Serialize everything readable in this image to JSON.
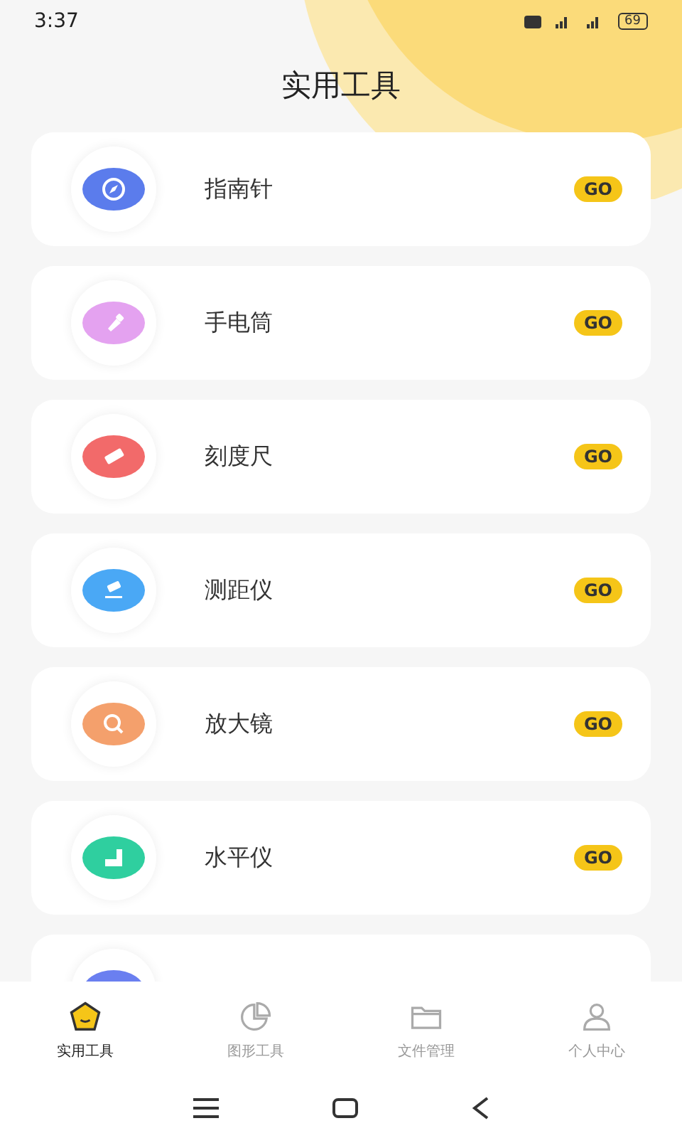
{
  "status_bar": {
    "time": "3:37",
    "battery": "69"
  },
  "header": {
    "title": "实用工具"
  },
  "tools": [
    {
      "label": "指南针",
      "kind": "compass",
      "color": "#5b7cec",
      "action": "GO"
    },
    {
      "label": "手电筒",
      "kind": "flashlight",
      "color": "#e4a2f0",
      "action": "GO"
    },
    {
      "label": "刻度尺",
      "kind": "ruler",
      "color": "#f26a6a",
      "action": "GO"
    },
    {
      "label": "测距仪",
      "kind": "rangefinder",
      "color": "#4aa8f5",
      "action": "GO"
    },
    {
      "label": "放大镜",
      "kind": "magnifier",
      "color": "#f4a06c",
      "action": "GO"
    },
    {
      "label": "水平仪",
      "kind": "level",
      "color": "#2fcf9f",
      "action": "GO"
    },
    {
      "kind": "partial",
      "color": "#6a7ff0"
    }
  ],
  "tabs": [
    {
      "label": "实用工具",
      "kind": "tools",
      "selected": true
    },
    {
      "label": "图形工具",
      "kind": "chart",
      "selected": false
    },
    {
      "label": "文件管理",
      "kind": "folder",
      "selected": false
    },
    {
      "label": "个人中心",
      "kind": "person",
      "selected": false
    }
  ]
}
